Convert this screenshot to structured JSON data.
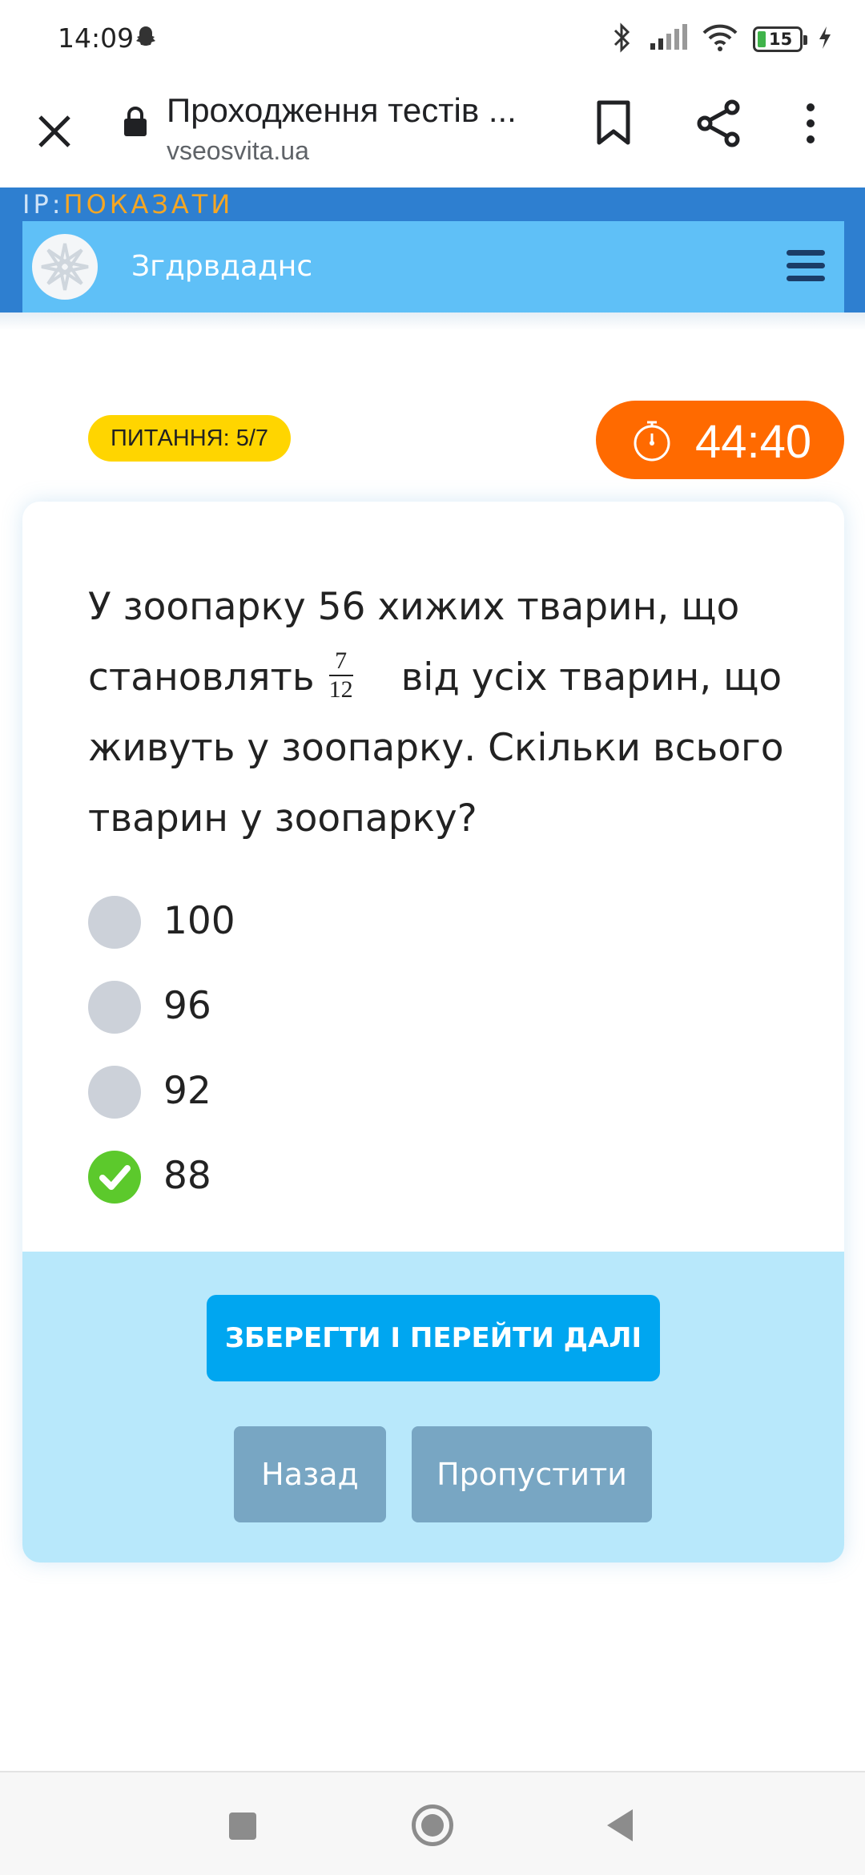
{
  "status_bar": {
    "time": "14:09",
    "battery": "15",
    "icons": [
      "snapchat-icon",
      "bluetooth-icon",
      "signal-icon",
      "wifi-icon",
      "battery-icon",
      "charging-icon"
    ]
  },
  "browser": {
    "title": "Проходження тестів ...",
    "url": "vseosvita.ua"
  },
  "site": {
    "ip_label": "IP:",
    "ip_show": "ПОКАЗАТИ",
    "name": "Згдрвдаднс"
  },
  "quiz": {
    "question_badge": "ПИТАННЯ: 5/7",
    "timer": "44:40",
    "question_before": "У зоопарку  56 хижих тварин, що становлять",
    "fraction_numerator": "7",
    "fraction_denominator": "12",
    "question_after": "від усіх тварин, що живуть у зоопарку. Скільки всього тварин у зоопарку?",
    "options": [
      {
        "label": "100",
        "selected": false
      },
      {
        "label": "96",
        "selected": false
      },
      {
        "label": "92",
        "selected": false
      },
      {
        "label": "88",
        "selected": true
      }
    ],
    "save_button": "ЗБЕРЕГТИ І ПЕРЕЙТИ ДАЛІ",
    "back_button": "Назад",
    "skip_button": "Пропустити"
  },
  "colors": {
    "header_blue": "#5fc0f7",
    "badge_yellow": "#ffd500",
    "timer_orange": "#ff6a00",
    "primary_button": "#00a6f0",
    "selected_green": "#5cc92c"
  }
}
